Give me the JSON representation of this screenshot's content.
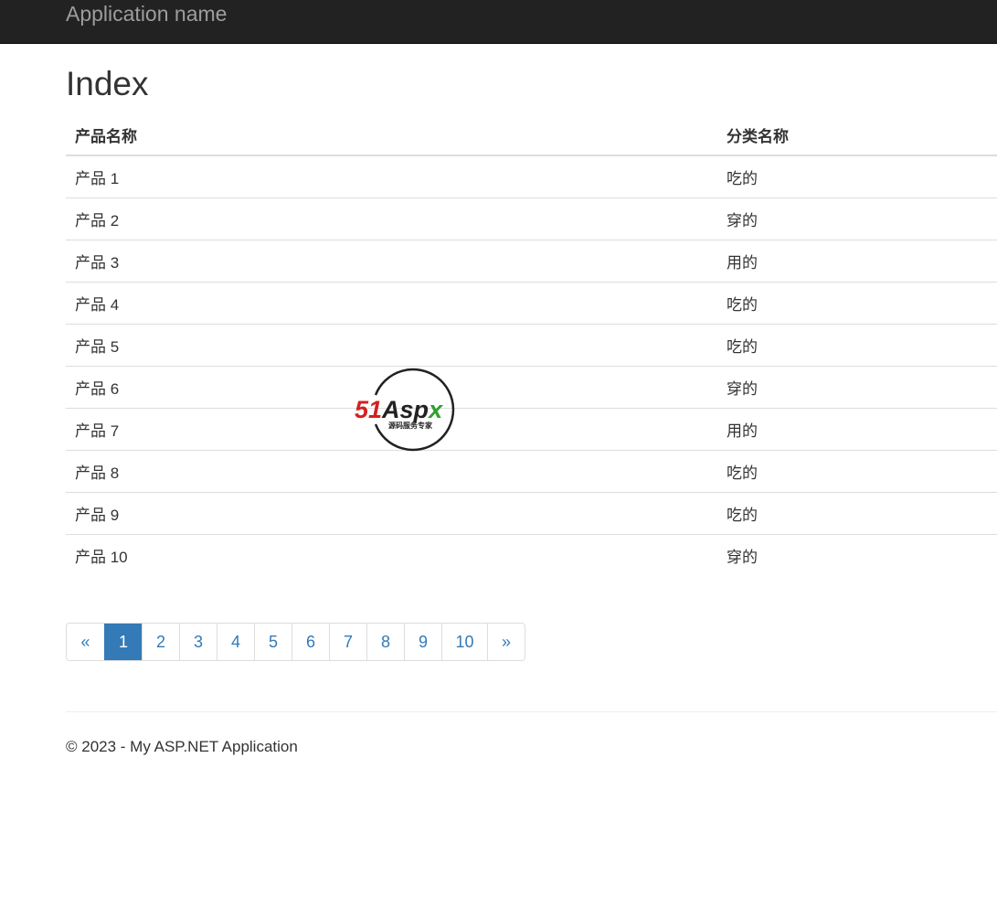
{
  "navbar": {
    "brand": "Application name"
  },
  "page": {
    "title": "Index"
  },
  "table": {
    "headers": {
      "name": "产品名称",
      "category": "分类名称"
    },
    "rows": [
      {
        "name": "产品 1",
        "category": "吃的"
      },
      {
        "name": "产品 2",
        "category": "穿的"
      },
      {
        "name": "产品 3",
        "category": "用的"
      },
      {
        "name": "产品 4",
        "category": "吃的"
      },
      {
        "name": "产品 5",
        "category": "吃的"
      },
      {
        "name": "产品 6",
        "category": "穿的"
      },
      {
        "name": "产品 7",
        "category": "用的"
      },
      {
        "name": "产品 8",
        "category": "吃的"
      },
      {
        "name": "产品 9",
        "category": "吃的"
      },
      {
        "name": "产品 10",
        "category": "穿的"
      }
    ]
  },
  "pagination": {
    "prev": "«",
    "next": "»",
    "current": "1",
    "pages": [
      "1",
      "2",
      "3",
      "4",
      "5",
      "6",
      "7",
      "8",
      "9",
      "10"
    ]
  },
  "footer": {
    "text": "© 2023 - My ASP.NET Application"
  },
  "watermark": {
    "brand_red": "51",
    "brand_dark": "Asp",
    "brand_green": "x",
    "tagline": "源码服务专家"
  },
  "colors": {
    "navbar_bg": "#222222",
    "brand_text": "#9d9d9d",
    "link": "#337ab7",
    "active_page_bg": "#337ab7",
    "row_border": "#dddddd",
    "watermark_red": "#d42020",
    "watermark_green": "#2ea02e"
  }
}
